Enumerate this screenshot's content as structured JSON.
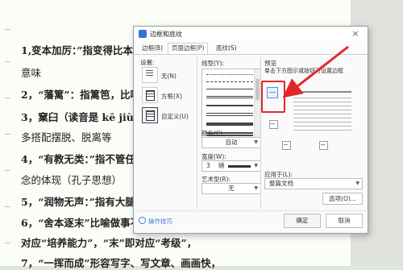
{
  "document": {
    "lines": [
      "1,变本加厉：”指变得比本",
      "意味",
      "2，“藩篱”：指篱笆，比喻",
      "3，窠臼（读音是 kē jiù）",
      "多搭配摆脱、脱离等",
      "4，“有教无类：”指不管任",
      "念的体现（孔子思想）",
      "5，“润物无声：”指有大腿",
      "6，“舍本逐末”比喻做事不",
      "对应“培养能力”，“末”即对应“考级”，",
      "7，“一挥而成”形容写字、写文章、画画快，"
    ]
  },
  "dialog": {
    "title": "边框和底纹",
    "close_label": "×",
    "tabs": [
      "边框(B)",
      "页面边框(P)",
      "底纹(S)"
    ],
    "active_tab": "页面边框(P)",
    "settings_label": "设置:",
    "settings": [
      "无(N)",
      "方框(X)",
      "自定义(U)"
    ],
    "selected_setting": "自定义(U)",
    "line_style_label": "线型(Y):",
    "color_label": "颜色(C):",
    "color_value": "自动",
    "width_label": "宽度(W):",
    "width_value": "3",
    "width_unit": "磅",
    "art_label": "艺术型(R):",
    "art_value": "无",
    "preview_label": "预览",
    "preview_hint": "单击下方图示或按钮可设置边框",
    "apply_label": "应用于(L):",
    "apply_value": "整篇文档",
    "options_button": "选项(O)...",
    "tips_link": "操作技巧",
    "ok_button": "确定",
    "cancel_button": "取消"
  },
  "colors": {
    "annotation_red": "#e0282a",
    "page_background": "#fbfdf8",
    "link_blue": "#3f7bd4"
  }
}
